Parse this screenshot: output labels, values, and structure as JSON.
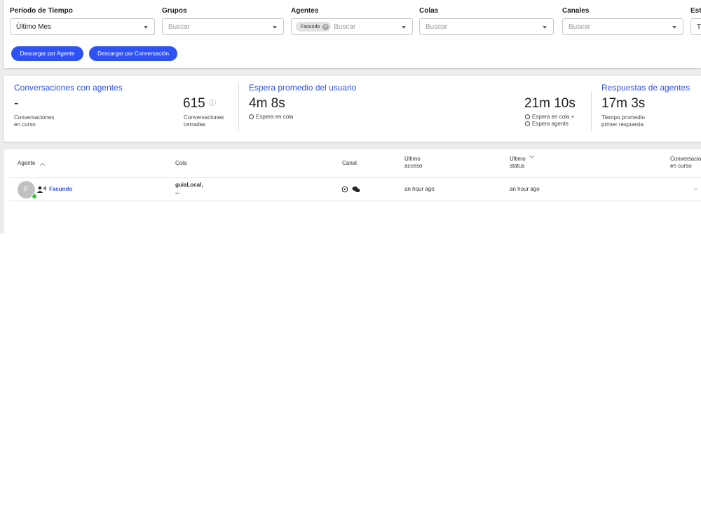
{
  "filters": {
    "periodo": {
      "label": "Período de Tiempo",
      "value": "Último Mes"
    },
    "grupos": {
      "label": "Grupos",
      "placeholder": "Buscar"
    },
    "agentes": {
      "label": "Agentes",
      "chip": "Facundo",
      "placeholder": "Buscar"
    },
    "colas": {
      "label": "Colas",
      "placeholder": "Buscar"
    },
    "canales": {
      "label": "Canales",
      "placeholder": "Buscar"
    },
    "estado": {
      "label": "Est",
      "value": "T"
    }
  },
  "buttons": {
    "download_agent": "Descargar por Agente",
    "download_conversation": "Descargar por Conversación"
  },
  "stats": {
    "conversations": {
      "title": "Conversaciones con agentes",
      "in_progress_value": "-",
      "in_progress_label_1": "Conversaciones",
      "in_progress_label_2": "en curso",
      "closed_value": "615",
      "closed_label_1": "Conversaciones",
      "closed_label_2": "cerradas"
    },
    "wait": {
      "title": "Espera promedio del usuario",
      "queue_value": "4m 8s",
      "queue_label": "Espera en cola",
      "total_value": "21m 10s",
      "total_label_1": "Espera en cola +",
      "total_label_2": "Espera agente"
    },
    "responses": {
      "title": "Respuestas de agentes",
      "value": "17m 3s",
      "label_1": "Tiempo promedio",
      "label_2": "primer respuesta"
    }
  },
  "table": {
    "headers": {
      "agente": "Agente",
      "cola": "Cola",
      "canal": "Canal",
      "ultimo_acceso_1": "Último",
      "ultimo_acceso_2": "acceso",
      "ultimo_status_1": "Último",
      "ultimo_status_2": "status",
      "conversaciones_1": "Conversacio",
      "conversaciones_2": "en curso"
    },
    "rows": [
      {
        "initial": "F",
        "agent": "Facundo",
        "queue_1": "guiaLocal,",
        "queue_2": "...",
        "last_access": "an hour ago",
        "last_status": "an hour ago",
        "in_progress": "–"
      }
    ]
  },
  "colors": {
    "accent": "#2f52f4",
    "online": "#3ec43e"
  }
}
